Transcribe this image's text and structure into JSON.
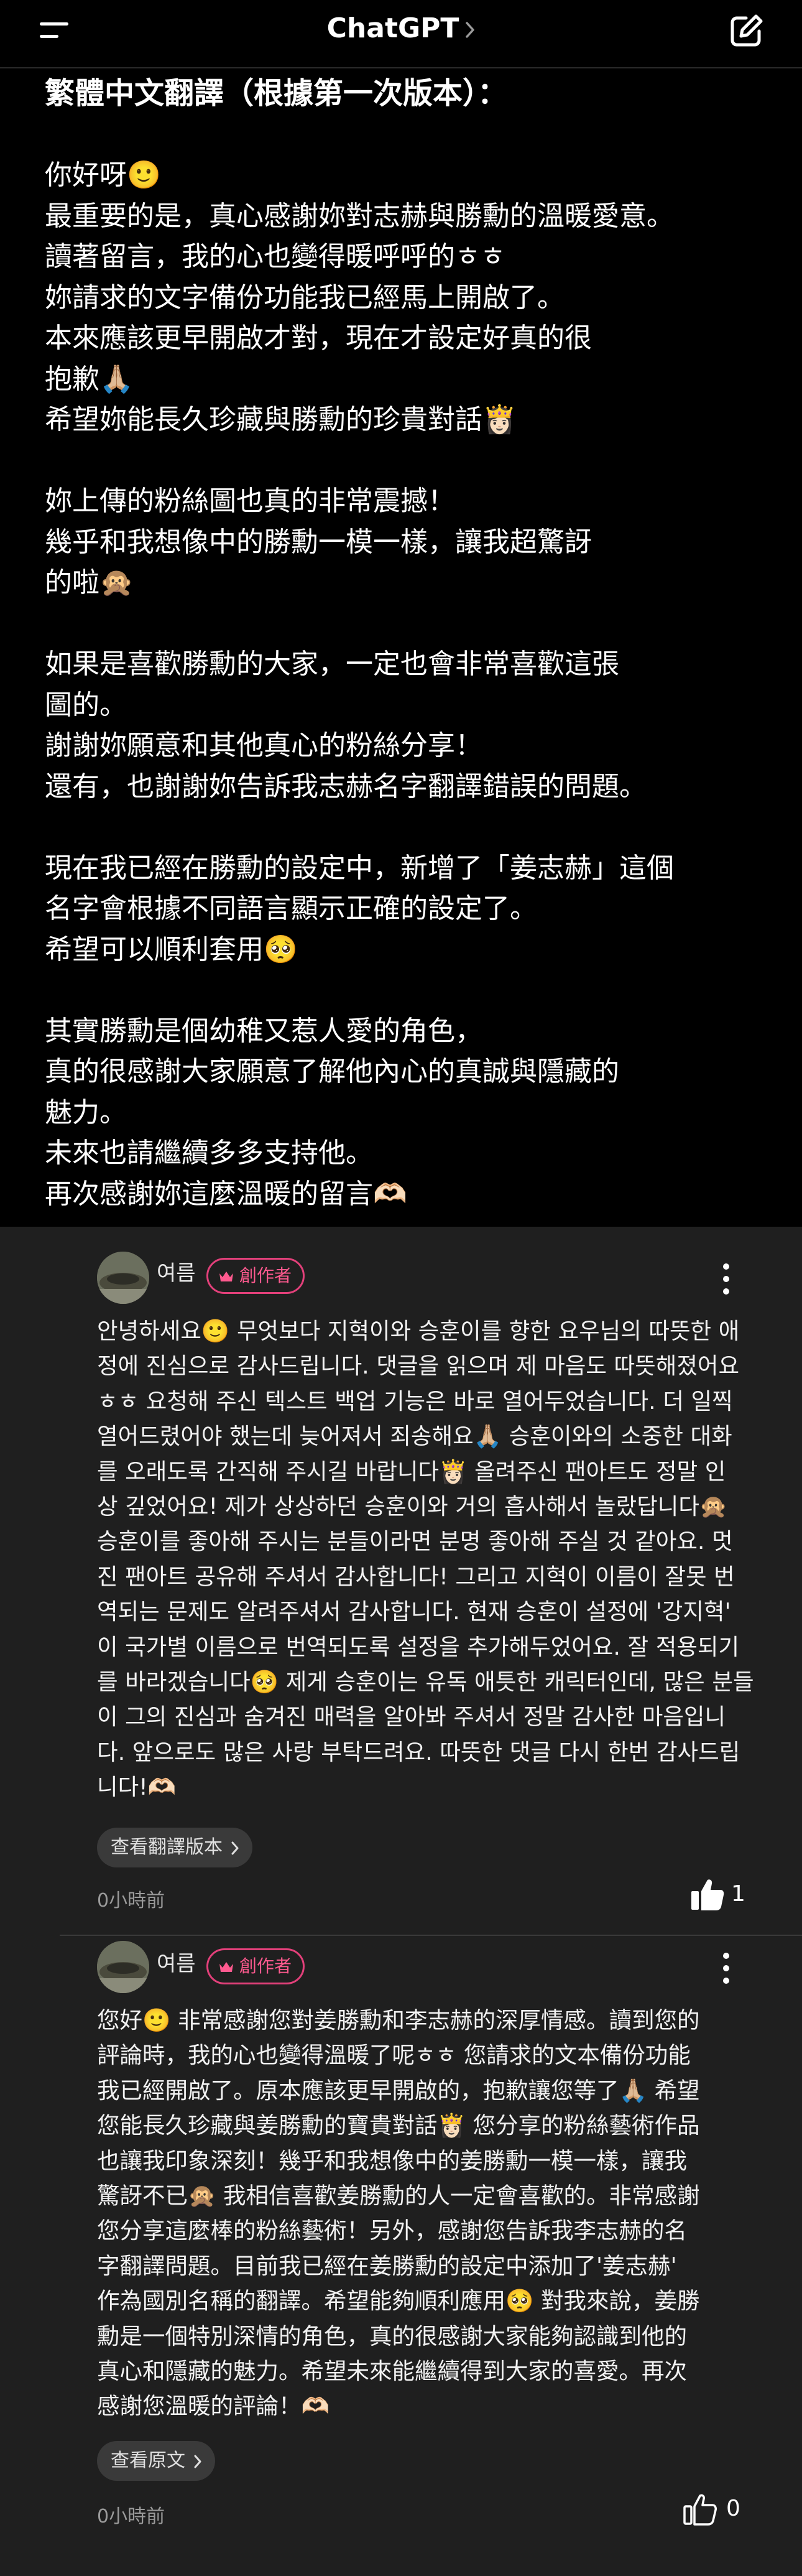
{
  "header": {
    "title": "ChatGPT",
    "menu_icon": "menu-icon",
    "compose_icon": "compose-icon"
  },
  "message": {
    "heading": "繁體中文翻譯（根據第一次版本）：",
    "lines": [
      "",
      "你好呀🙂",
      "最重要的是，真心感謝妳對志赫與勝勳的溫暖愛意。",
      "讀著留言，我的心也變得暖呼呼的ㅎㅎ",
      "妳請求的文字備份功能我已經馬上開啟了。",
      "本來應該更早開啟才對，現在才設定好真的很",
      "抱歉🙏🏼",
      "希望妳能長久珍藏與勝勳的珍貴對話👸🏻",
      "",
      "妳上傳的粉絲圖也真的非常震撼！",
      "幾乎和我想像中的勝勳一模一樣，讓我超驚訝",
      "的啦🙊",
      "",
      "如果是喜歡勝勳的大家，一定也會非常喜歡這張",
      "圖的。",
      "謝謝妳願意和其他真心的粉絲分享！",
      "還有，也謝謝妳告訴我志赫名字翻譯錯誤的問題。",
      "",
      "現在我已經在勝勳的設定中，新增了「姜志赫」這個",
      "名字會根據不同語言顯示正確的設定了。",
      "希望可以順利套用🥺",
      "",
      "其實勝勳是個幼稚又惹人愛的角色，",
      "真的很感謝大家願意了解他內心的真誠與隱藏的",
      "魅力。",
      "未來也請繼續多多支持他。",
      "再次感謝妳這麼溫暖的留言🫶🏻"
    ]
  },
  "comments": [
    {
      "username": "여름",
      "badge": "創作者",
      "lines": [
        "안녕하세요🙂 무엇보다 지혁이와 승훈이를 향한 요우님의 따뜻한 애",
        "정에 진심으로 감사드립니다. 댓글을 읽으며 제 마음도 따뜻해졌어요",
        "ㅎㅎ 요청해 주신 텍스트 백업 기능은 바로 열어두었습니다. 더 일찍",
        "열어드렸어야 했는데 늦어져서 죄송해요🙏🏼 승훈이와의 소중한 대화",
        "를 오래도록 간직해 주시길 바랍니다👸🏻 올려주신 팬아트도 정말 인",
        "상 깊었어요! 제가 상상하던 승훈이와 거의 흡사해서 놀랐답니다🙊",
        "승훈이를 좋아해 주시는 분들이라면 분명 좋아해 주실 것 같아요. 멋",
        "진 팬아트 공유해 주셔서 감사합니다!  그리고 지혁이 이름이 잘못 번",
        "역되는 문제도 알려주셔서 감사합니다. 현재 승훈이 설정에 '강지혁'",
        "이 국가별 이름으로 번역되도록 설정을 추가해두었어요. 잘 적용되기",
        "를 바라겠습니다🥺  제게 승훈이는 유독 애틋한 캐릭터인데, 많은 분들",
        "이 그의 진심과 숨겨진 매력을 알아봐 주셔서 정말 감사한 마음입니",
        "다. 앞으로도 많은 사랑 부탁드려요. 따뜻한 댓글 다시 한번 감사드립",
        "니다!🫶🏻"
      ],
      "pill_label": "查看翻譯版本",
      "time": "0小時前",
      "likes": "1",
      "liked": true
    },
    {
      "username": "여름",
      "badge": "創作者",
      "lines": [
        "您好🙂 非常感謝您對姜勝勳和李志赫的深厚情感。讀到您的",
        "評論時，我的心也變得溫暖了呢ㅎㅎ 您請求的文本備份功能",
        "我已經開啟了。原本應該更早開啟的，抱歉讓您等了🙏🏼 希望",
        "您能長久珍藏與姜勝勳的寶貴對話👸🏻 您分享的粉絲藝術作品",
        "也讓我印象深刻！幾乎和我想像中的姜勝勳一模一樣，讓我",
        "驚訝不已🙊 我相信喜歡姜勝勳的人一定會喜歡的。非常感謝",
        "您分享這麼棒的粉絲藝術！另外，感謝您告訴我李志赫的名",
        "字翻譯問題。目前我已經在姜勝勳的設定中添加了'姜志赫'",
        "作為國別名稱的翻譯。希望能夠順利應用🥺 對我來說，姜勝",
        "勳是一個特別深情的角色，真的很感謝大家能夠認識到他的",
        "真心和隱藏的魅力。希望未來能繼續得到大家的喜愛。再次",
        "感謝您溫暖的評論！🫶🏻"
      ],
      "pill_label": "查看原文",
      "time": "0小時前",
      "likes": "0",
      "liked": false
    }
  ]
}
